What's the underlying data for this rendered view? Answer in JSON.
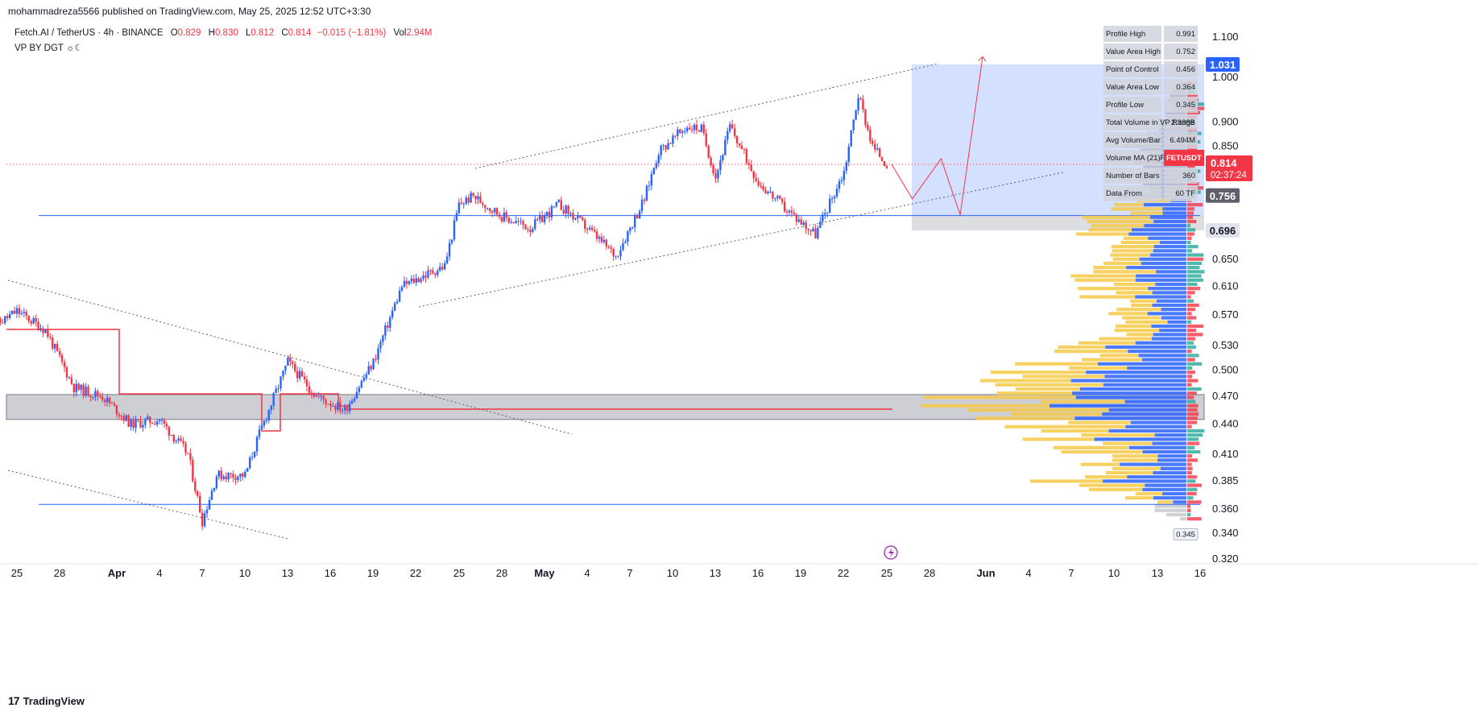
{
  "header": {
    "published": "mohammadreza5566 published on TradingView.com, May 25, 2025 12:52 UTC+3:30"
  },
  "legend": {
    "symbol": "Fetch.AI / TetherUS · 4h · BINANCE",
    "o_label": "O",
    "o_value": "0.829",
    "h_label": "H",
    "h_value": "0.830",
    "l_label": "L",
    "l_value": "0.812",
    "c_label": "C",
    "c_value": "0.814",
    "change": "−0.015 (−1.81%)",
    "vol_label": "Vol",
    "vol_value": "2.94M",
    "indicator": "VP BY DGT ☼☾"
  },
  "footer": {
    "brand": "TradingView",
    "logo": "17"
  },
  "stats": [
    {
      "label": "Profile High",
      "value": "0.991"
    },
    {
      "label": "Value Area High",
      "value": "0.752"
    },
    {
      "label": "Point of Control",
      "value": "0.456"
    },
    {
      "label": "Value Area Low",
      "value": "0.364"
    },
    {
      "label": "Profile Low",
      "value": "0.345"
    },
    {
      "label": "Total Volume in VP Range",
      "value": "2.338B"
    },
    {
      "label": "Avg Volume/Bar",
      "value": "6.494M"
    },
    {
      "label": "Volume MA (21)",
      "value": "FETUSDT"
    },
    {
      "label": "Number of Bars",
      "value": "360"
    },
    {
      "label": "Data From",
      "value": "60 TF"
    }
  ],
  "badges": {
    "target": "1.031",
    "price": "0.814",
    "countdown": "02:37:24",
    "level1": "0.756",
    "level2": "0.696",
    "profile_low": "0.345"
  },
  "colors": {
    "up": "#2962ff",
    "down": "#f23645",
    "vp_yellow": "#f7c948",
    "vp_blue": "#2962ff",
    "vp_red": "#f23645",
    "vp_green": "#26a69a",
    "target_box": "#2962ff",
    "zone_gray": "#b2b5be"
  },
  "chart_data": {
    "type": "candlestick",
    "symbol": "FETUSDT",
    "interval": "4h",
    "exchange": "BINANCE",
    "x_ticks": [
      "25",
      "28",
      "Apr",
      "4",
      "7",
      "10",
      "13",
      "16",
      "19",
      "22",
      "25",
      "28",
      "May",
      "4",
      "7",
      "10",
      "13",
      "16",
      "19",
      "22",
      "25",
      "28",
      "Jun",
      "4",
      "7",
      "10",
      "13",
      "16"
    ],
    "y_ticks": [
      "1.100",
      "1.000",
      "0.900",
      "0.850",
      "0.650",
      "0.610",
      "0.570",
      "0.530",
      "0.500",
      "0.470",
      "0.440",
      "0.410",
      "0.385",
      "0.360",
      "0.340",
      "0.320"
    ],
    "y_scale": "log",
    "ylim": [
      0.31,
      1.14
    ],
    "price_path": [
      [
        "Mar 23",
        0.55
      ],
      [
        "Mar 25",
        0.575
      ],
      [
        "Mar 27",
        0.55
      ],
      [
        "Mar 29",
        0.48
      ],
      [
        "Mar 31",
        0.47
      ],
      [
        "Apr 2",
        0.44
      ],
      [
        "Apr 4",
        0.445
      ],
      [
        "Apr 6",
        0.41
      ],
      [
        "Apr 7",
        0.35
      ],
      [
        "Apr 8",
        0.39
      ],
      [
        "Apr 10",
        0.39
      ],
      [
        "Apr 11",
        0.43
      ],
      [
        "Apr 13",
        0.51
      ],
      [
        "Apr 15",
        0.47
      ],
      [
        "Apr 17",
        0.455
      ],
      [
        "Apr 19",
        0.51
      ],
      [
        "Apr 21",
        0.61
      ],
      [
        "Apr 22",
        0.62
      ],
      [
        "Apr 24",
        0.64
      ],
      [
        "Apr 25",
        0.74
      ],
      [
        "Apr 26",
        0.755
      ],
      [
        "Apr 28",
        0.72
      ],
      [
        "Apr 30",
        0.7
      ],
      [
        "May 2",
        0.74
      ],
      [
        "May 4",
        0.7
      ],
      [
        "May 6",
        0.655
      ],
      [
        "May 8",
        0.75
      ],
      [
        "May 9",
        0.84
      ],
      [
        "May 11",
        0.89
      ],
      [
        "May 12",
        0.885
      ],
      [
        "May 13",
        0.79
      ],
      [
        "May 14",
        0.89
      ],
      [
        "May 16",
        0.78
      ],
      [
        "May 18",
        0.73
      ],
      [
        "May 19",
        0.71
      ],
      [
        "May 20",
        0.69
      ],
      [
        "May 22",
        0.8
      ],
      [
        "May 23",
        0.96
      ],
      [
        "May 24",
        0.85
      ],
      [
        "May 25",
        0.814
      ]
    ],
    "forecast_path": [
      [
        "May 25",
        0.814
      ],
      [
        "May 26",
        0.75
      ],
      [
        "May 27",
        0.825
      ],
      [
        "May 28",
        0.722
      ],
      [
        "Jun 1",
        1.05
      ]
    ],
    "levels": {
      "horizontal_blue_1": 0.721,
      "horizontal_blue_2": 0.364,
      "poc_line": 0.456,
      "current_price_dotted": 0.814,
      "gray_zone": [
        0.445,
        0.472
      ]
    },
    "target_box": {
      "from": "May 25",
      "to": "Jun 15",
      "top": 1.031,
      "bottom": 0.696
    },
    "volume_profile_levels": [
      {
        "price": 0.98,
        "vol": 0.05
      },
      {
        "price": 0.93,
        "vol": 0.09
      },
      {
        "price": 0.88,
        "vol": 0.16
      },
      {
        "price": 0.85,
        "vol": 0.22
      },
      {
        "price": 0.82,
        "vol": 0.18
      },
      {
        "price": 0.78,
        "vol": 0.2
      },
      {
        "price": 0.74,
        "vol": 0.32
      },
      {
        "price": 0.7,
        "vol": 0.45
      },
      {
        "price": 0.66,
        "vol": 0.3
      },
      {
        "price": 0.62,
        "vol": 0.5
      },
      {
        "price": 0.58,
        "vol": 0.25
      },
      {
        "price": 0.54,
        "vol": 0.38
      },
      {
        "price": 0.5,
        "vol": 0.65
      },
      {
        "price": 0.47,
        "vol": 0.92
      },
      {
        "price": 0.456,
        "vol": 1.0
      },
      {
        "price": 0.43,
        "vol": 0.6
      },
      {
        "price": 0.4,
        "vol": 0.45
      },
      {
        "price": 0.385,
        "vol": 0.55
      },
      {
        "price": 0.37,
        "vol": 0.2
      },
      {
        "price": 0.355,
        "vol": 0.08
      }
    ]
  }
}
